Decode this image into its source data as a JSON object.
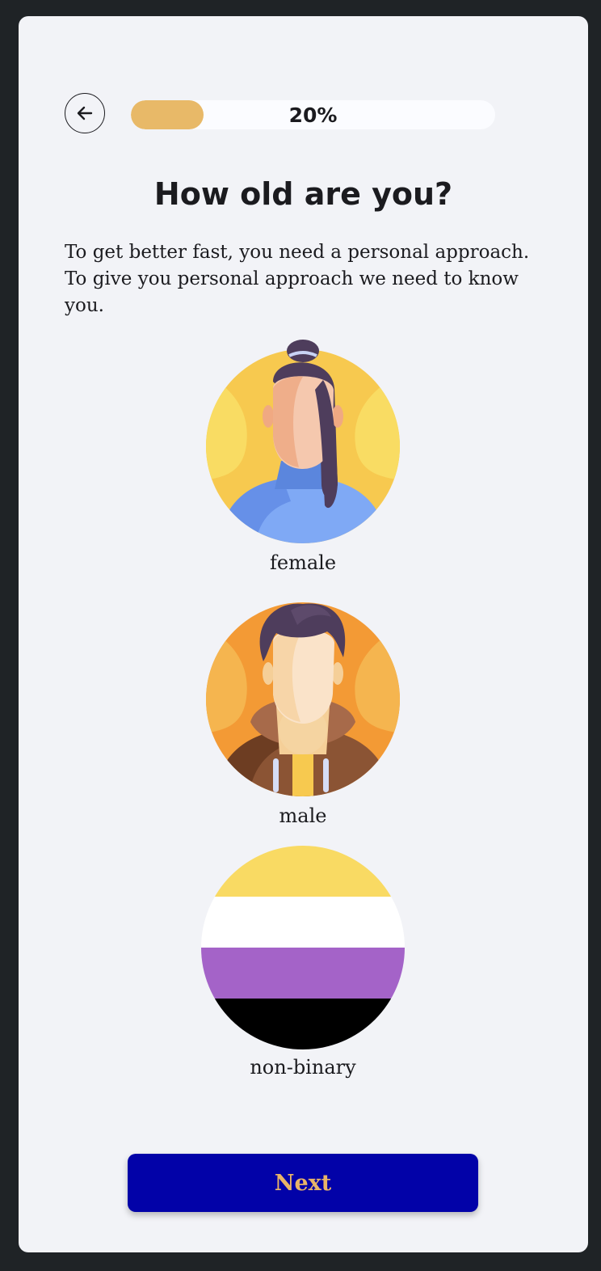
{
  "header": {
    "back_icon": "arrow-left-icon",
    "progress_percent": 20,
    "progress_label": "20%"
  },
  "question": {
    "title": "How old are you?",
    "description": "To get better fast, you need a personal approach. To give you personal approach we need to know you."
  },
  "options": [
    {
      "label": "female",
      "icon": "female-avatar-icon"
    },
    {
      "label": "male",
      "icon": "male-avatar-icon"
    },
    {
      "label": "non-binary",
      "icon": "nonbinary-flag-icon"
    }
  ],
  "footer": {
    "next_label": "Next"
  },
  "colors": {
    "progress_fill": "#e8b968",
    "next_bg": "#0202a8",
    "next_text": "#e8b468",
    "card_bg": "#f2f3f7",
    "outer_bg": "#1f2326"
  }
}
